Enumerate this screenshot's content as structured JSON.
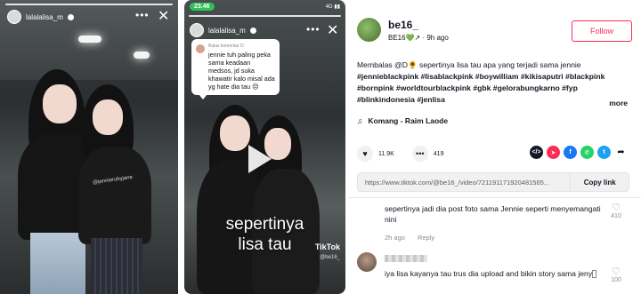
{
  "story1": {
    "username": "lalalalisa_m",
    "shirt_text": "@jennierubyjane"
  },
  "story2": {
    "status_time": "23.46",
    "status_right": "4G ▮▮",
    "username": "lalalalisa_m",
    "comment_reply_label": "Balas komentar D",
    "comment_text": "jennie tuh paling peka sama keadaan medsos, jd suka khawatir kalo misal ada yg hate dia tau 😔",
    "caption_line1": "sepertinya",
    "caption_line2": "lisa tau",
    "watermark": "TikTok",
    "watermark_id": "@be16_"
  },
  "page": {
    "username": "be16_",
    "subline": "BE16💚↗",
    "time_ago": "9h ago",
    "follow_label": "Follow",
    "description": "Membalas @D🌻 sepertinya lisa tau apa yang terjadi sama jennie",
    "hashtags": "#jennieblackpink #lisablackpink #boywilliam #kikisaputri #blackpink #bornpink #worldtourblackpink #gbk #gelorabungkarno #fyp #blinkindonesia #jenlisa",
    "more_label": "more",
    "music": "Komang - Raim Laode",
    "likes": "11.9K",
    "comments": "419",
    "link": "https://www.tiktok.com/@be16_/video/721191171920481565...",
    "copy_label": "Copy link",
    "share_colors": {
      "embed": "#161823",
      "send": "#fe2c55",
      "facebook": "#1877f2",
      "whatsapp": "#25d366",
      "twitter": "#1da1f2"
    }
  },
  "comments": [
    {
      "text": "sepertinya jadi dia post foto sama Jennie seperti menyemangati nini",
      "time": "2h ago",
      "reply_label": "Reply",
      "likes": "410"
    },
    {
      "text": "iya lisa kayanya tau trus dia upload and bikin story sama jeny",
      "likes": "100"
    }
  ]
}
